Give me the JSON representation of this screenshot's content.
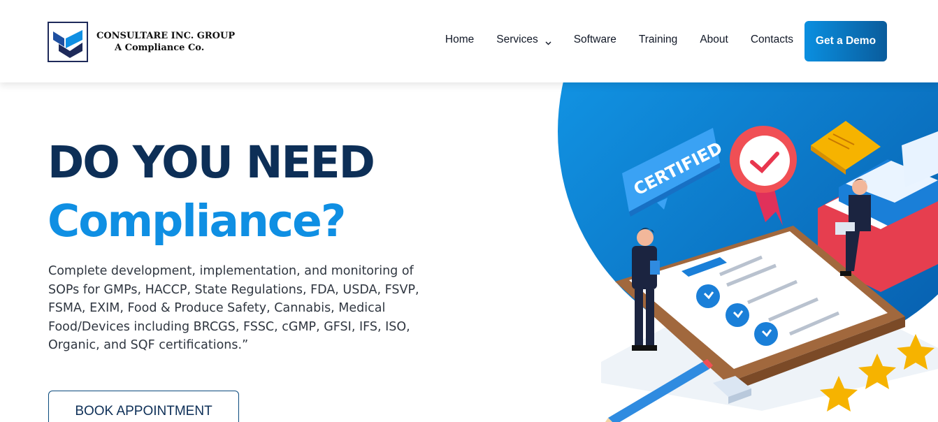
{
  "header": {
    "logo": {
      "line1": "CONSULTARE INC. GROUP",
      "line2": "A Compliance Co."
    },
    "nav": [
      {
        "label": "Home"
      },
      {
        "label": "Services",
        "has_dropdown": true
      },
      {
        "label": "Software"
      },
      {
        "label": "Training"
      },
      {
        "label": "About"
      },
      {
        "label": "Contacts"
      }
    ],
    "cta_label": "Get a Demo"
  },
  "hero": {
    "heading_line1": "DO YOU NEED",
    "heading_line2": "Compliance?",
    "description": "Complete development, implementation, and monitoring of SOPs for GMPs, HACCP, State Regulations, FDA, USDA, FSVP, FSMA, EXIM, Food & Produce Safety, Cannabis, Medical Food/Devices including BRCGS, FSSC, cGMP, GFSI, IFS, ISO, Organic, and SQF certifications.”",
    "book_button": "BOOK APPOINTMENT"
  },
  "illustration": {
    "badge_text": "CERTIFIED"
  },
  "colors": {
    "navy": "#0d2f57",
    "accent_blue": "#0f8fe3",
    "button_gradient_start": "#0a8fe0",
    "button_gradient_end": "#0a5c9c"
  }
}
